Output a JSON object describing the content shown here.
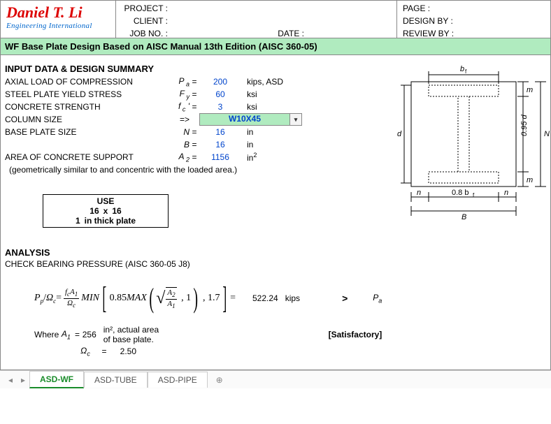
{
  "header": {
    "logo_name": "Daniel T. Li",
    "logo_sub": "Engineering International",
    "project_label": "PROJECT :",
    "client_label": "CLIENT :",
    "jobno_label": "JOB NO. :",
    "date_label": "DATE :",
    "page_label": "PAGE :",
    "designby_label": "DESIGN BY :",
    "reviewby_label": "REVIEW BY :"
  },
  "title": "WF Base Plate Design Based on AISC Manual 13th Edition (AISC 360-05)",
  "sect_input": "INPUT DATA & DESIGN SUMMARY",
  "inputs": {
    "axial": {
      "label": "AXIAL LOAD OF COMPRESSION",
      "sym": "P a",
      "val": "200",
      "unit": "kips, ASD"
    },
    "fy": {
      "label": "STEEL PLATE YIELD STRESS",
      "sym": "F y",
      "val": "60",
      "unit": "ksi"
    },
    "fc": {
      "label": "CONCRETE STRENGTH",
      "sym": "f c '",
      "val": "3",
      "unit": "ksi"
    },
    "col": {
      "label": "COLUMN SIZE",
      "sym": "=>",
      "val": "W10X45"
    },
    "N": {
      "label": "BASE PLATE SIZE",
      "sym": "N",
      "val": "16",
      "unit": "in"
    },
    "B": {
      "sym": "B",
      "val": "16",
      "unit": "in"
    },
    "A2": {
      "label": "AREA OF CONCRETE SUPPORT",
      "sym": "A 2",
      "val": "1156",
      "unit": "in²"
    }
  },
  "note": "(geometrically similar to and concentric with the loaded area.)",
  "use": {
    "title": "USE",
    "dim1": "16",
    "x": "x",
    "dim2": "16",
    "thk": "1",
    "thk_txt": "in thick plate"
  },
  "sect_analysis": "ANALYSIS",
  "bearing_title": "CHECK BEARING PRESSURE (AISC 360-05 J8)",
  "formula": {
    "lhs": "P",
    "result": "522.24",
    "result_unit": "kips",
    "gt": ">",
    "rhs": "P",
    "rhs_sub": "a"
  },
  "where": {
    "label": "Where",
    "A1": {
      "sym": "A",
      "sub": "1",
      "val": "256",
      "unit": "in², actual area of base plate."
    },
    "Omega": {
      "sym": "Ω",
      "sub": "c",
      "val": "2.50"
    }
  },
  "satisfactory": "[Satisfactory]",
  "diagram": {
    "bf_top": "bf",
    "m_right": "m",
    "d095": "0.95 d",
    "N_right": "N",
    "d_left": "d",
    "n_bl": "n",
    "bf08": "0.8 bf",
    "n_br": "n",
    "B_bot": "B"
  },
  "tabs": [
    "ASD-WF",
    "ASD-TUBE",
    "ASD-PIPE"
  ]
}
